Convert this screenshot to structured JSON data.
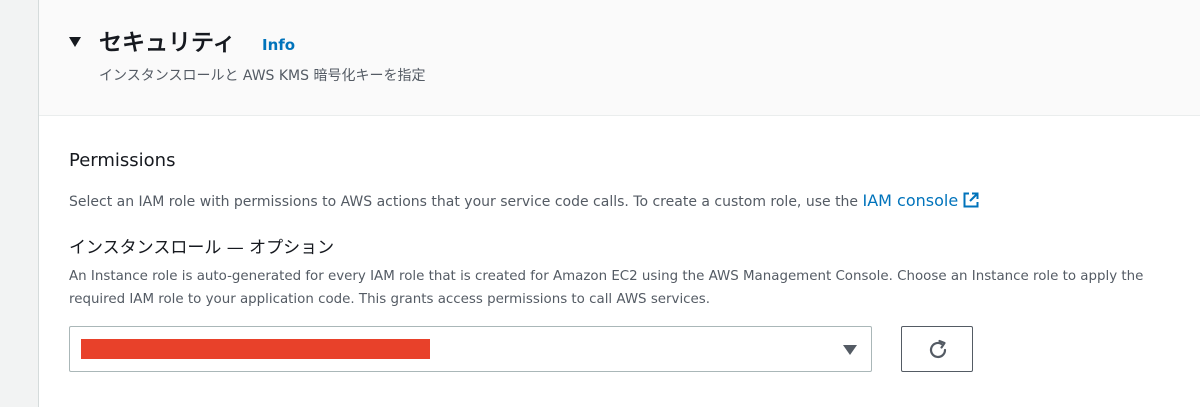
{
  "section": {
    "title": "セキュリティ",
    "info_link": "Info",
    "description": "インスタンスロールと AWS KMS 暗号化キーを指定"
  },
  "permissions": {
    "title": "Permissions",
    "description": "Select an IAM role with permissions to AWS actions that your service code calls. To create a custom role, use the ",
    "iam_link": "IAM console"
  },
  "instance_role": {
    "label": "インスタンスロール — オプション",
    "description": "An Instance role is auto-generated for every IAM role that is created for Amazon EC2 using the AWS Management Console. Choose an Instance role to apply the required IAM role to your application code. This grants access permissions to call AWS services."
  },
  "icons": {
    "section_toggle": "caret-down-icon",
    "external_link": "external-link-icon",
    "select_dropdown": "caret-down-icon",
    "refresh": "refresh-icon"
  },
  "colors": {
    "link": "#0073bb",
    "redaction": "#e8412a"
  }
}
